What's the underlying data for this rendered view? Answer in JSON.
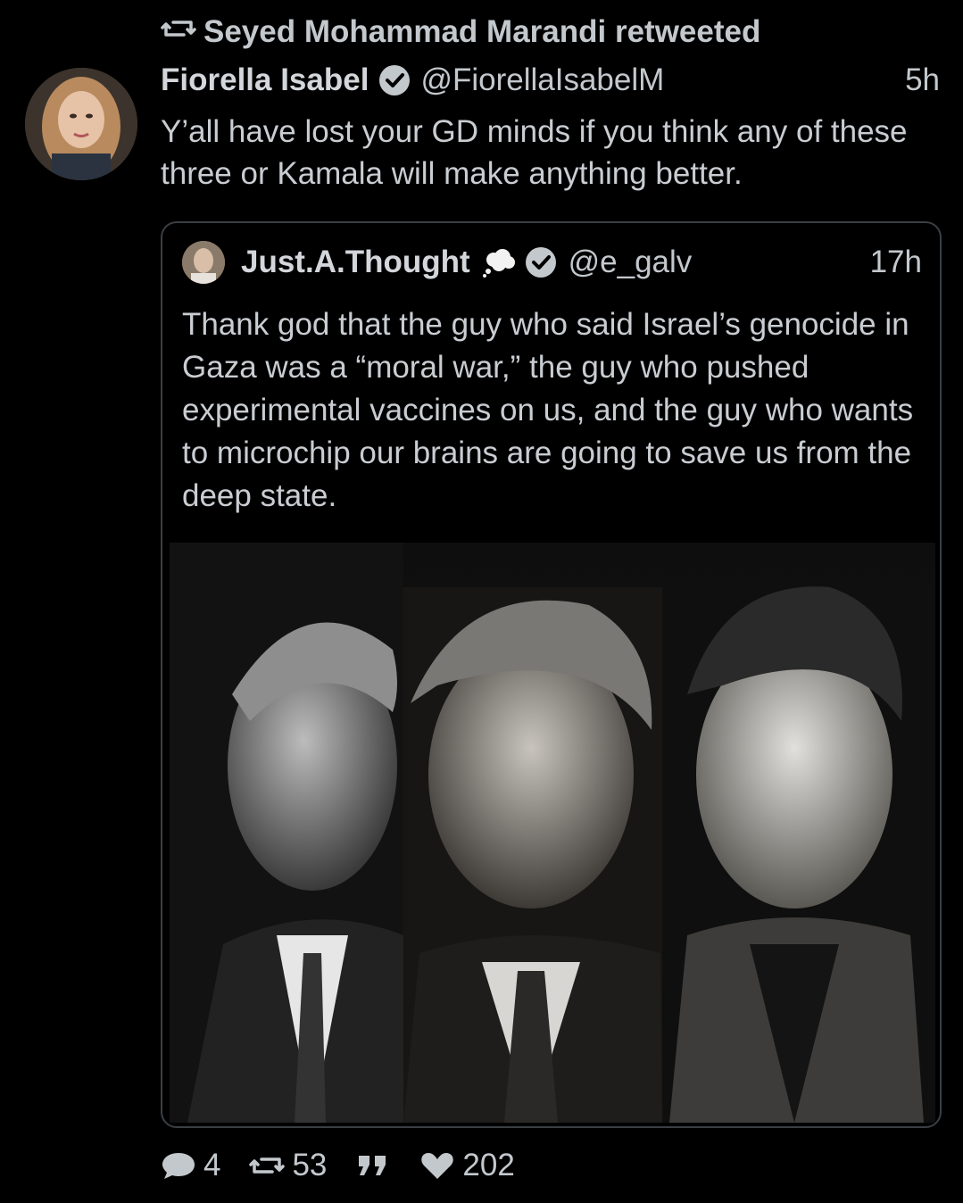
{
  "retweet_banner": {
    "icon": "retweet-icon",
    "text": "Seyed Mohammad Marandi retweeted"
  },
  "tweet": {
    "author_name": "Fiorella Isabel",
    "author_handle": "@FiorellaIsabelM",
    "time": "5h",
    "text": "Y’all have lost your GD minds if you think any of these three or Kamala will make anything better."
  },
  "quoted_tweet": {
    "author_name": "Just.A.Thought",
    "author_emoji": "thought-balloon-icon",
    "author_handle": "@e_galv",
    "time": "17h",
    "text": "Thank god that the guy who said Israel’s genocide in Gaza was a “moral war,” the guy who pushed experimental vaccines on us, and the guy who wants to microchip our brains are going to save us from the deep state."
  },
  "actions": {
    "replies": "4",
    "retweets": "53",
    "quote_icon": "quote-icon",
    "likes": "202"
  },
  "colors": {
    "background": "#000000",
    "text": "#c9cdd2",
    "border": "#3a3f44",
    "verified": "#c3c8cd"
  }
}
